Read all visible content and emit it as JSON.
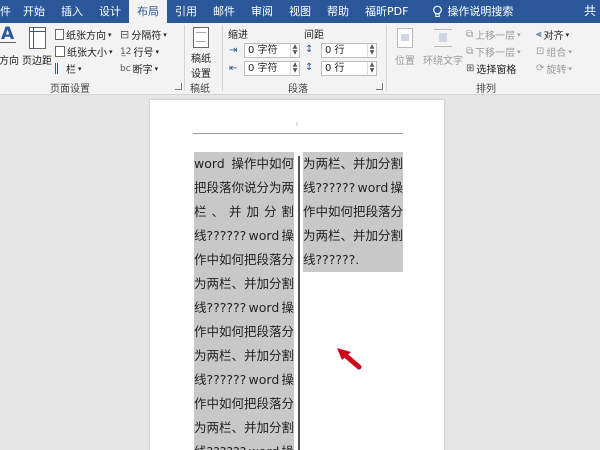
{
  "tabs": [
    "件",
    "开始",
    "插入",
    "设计",
    "布局",
    "引用",
    "邮件",
    "审阅",
    "视图",
    "帮助",
    "福昕PDF"
  ],
  "active_tab": "布局",
  "tell_me": "操作说明搜索",
  "user_initial": "共",
  "page_setup": {
    "group_label": "页面设置",
    "text_direction": "方向",
    "margins": "页边距",
    "orientation": "纸张方向",
    "size": "纸张大小",
    "columns": "栏",
    "breaks": "分隔符",
    "line_numbers": "行号",
    "hyphenation": "断字"
  },
  "manuscript": {
    "group_label": "稿纸",
    "settings_line1": "稿纸",
    "settings_line2": "设置"
  },
  "paragraph": {
    "group_label": "段落",
    "indent_label": "缩进",
    "spacing_label": "间距",
    "indent_left": "0 字符",
    "indent_right": "0 字符",
    "space_before": "0 行",
    "space_after": "0 行"
  },
  "arrange": {
    "group_label": "排列",
    "position": "位置",
    "wrap_text": "环绕文字",
    "bring_forward": "上移一层",
    "send_backward": "下移一层",
    "selection_pane": "选择窗格",
    "align": "对齐",
    "group": "组合",
    "rotate": "旋转"
  },
  "document": {
    "header_mark": "ı",
    "left_column": [
      [
        "word",
        "操作中如何"
      ],
      [
        "把段落你说分为两"
      ],
      [
        "栏",
        "、",
        "并",
        "加",
        "分",
        "割"
      ],
      [
        "线??????",
        "word",
        "操"
      ],
      [
        "作中如何把段落分"
      ],
      [
        "为两栏、并加分割"
      ],
      [
        "线??????",
        "word",
        "操"
      ],
      [
        "作中如何把段落分"
      ],
      [
        "为两栏、并加分割"
      ],
      [
        "线??????",
        "word",
        "操"
      ],
      [
        "作中如何把段落分"
      ],
      [
        "为两栏、并加分割"
      ],
      [
        "线??????",
        "word",
        "操"
      ]
    ],
    "right_column": [
      [
        "为两栏、并加分割"
      ],
      [
        "线??????",
        "word",
        "操"
      ],
      [
        "作中如何把段落分"
      ],
      [
        "为两栏、并加分割"
      ],
      [
        "线??????."
      ]
    ]
  },
  "colors": {
    "tab_bar": "#2b579a",
    "ribbon": "#f3f3f3",
    "selection": "#c8c8c8",
    "arrow": "#d0021b"
  }
}
